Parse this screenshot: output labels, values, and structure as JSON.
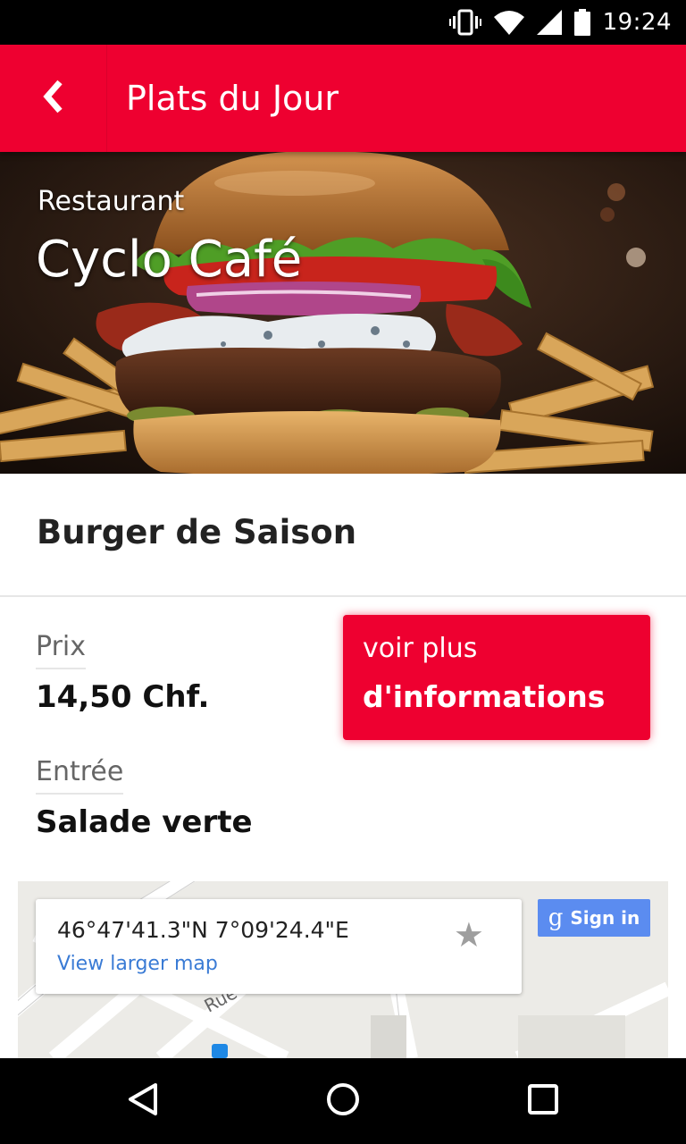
{
  "status_bar": {
    "time": "19:24",
    "icons": [
      "vibrate-icon",
      "wifi-icon",
      "signal-icon",
      "battery-icon"
    ]
  },
  "app_bar": {
    "title": "Plats du Jour",
    "back_icon": "chevron-left-icon",
    "color": "#ee0030"
  },
  "hero": {
    "kicker": "Restaurant",
    "name": "Cyclo Café"
  },
  "dish": {
    "title": "Burger de Saison"
  },
  "fields": {
    "price_label": "Prix",
    "price_value": "14,50 Chf.",
    "starter_label": "Entrée",
    "starter_value": "Salade verte"
  },
  "more_info_button": {
    "line1": "voir plus",
    "line2": "d'informations"
  },
  "map": {
    "coordinates": "46°47'41.3\"N 7°09'24.4\"E",
    "link_label": "View larger map",
    "sign_in_label": "Sign in",
    "road_label": "Rue"
  },
  "nav_bar": {
    "icons": [
      "back-triangle-icon",
      "home-circle-icon",
      "recents-square-icon"
    ]
  }
}
